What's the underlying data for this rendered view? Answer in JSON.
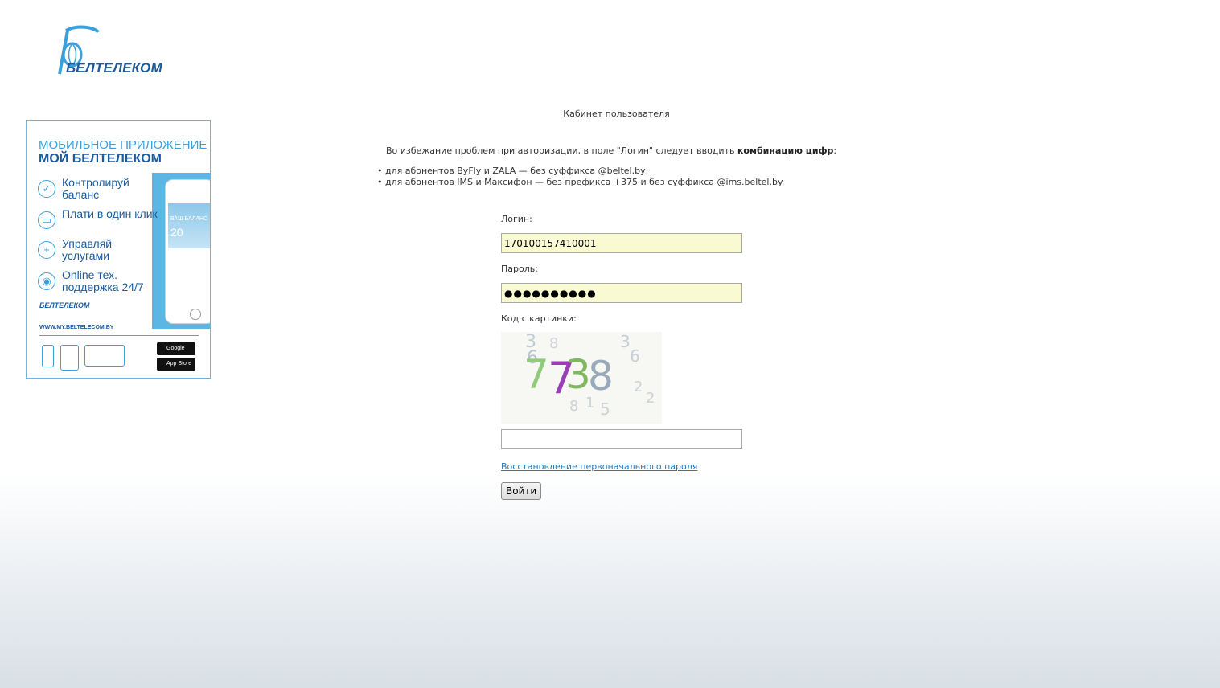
{
  "header": {
    "logo_text": "БЕЛТЕЛЕКОМ"
  },
  "banner": {
    "line1": "МОБИЛЬНОЕ ПРИЛОЖЕНИЕ",
    "line2": "МОЙ БЕЛТЕЛЕКОМ",
    "items": [
      "Контролируй баланс",
      "Плати в один клик",
      "Управляй услугами",
      "Online тех. поддержка 24/7"
    ],
    "phone_balance_label": "ВАШ БАЛАНС",
    "phone_balance_value": "20",
    "logo_text": "БЕЛТЕЛЕКОМ",
    "url": "WWW.MY.BELTELECOM.BY",
    "store_google": "Google Play",
    "store_apple": "App Store"
  },
  "page": {
    "title": "Кабинет пользователя"
  },
  "notice": {
    "text": "Во избежание проблем при авторизации, в поле \"Логин\" следует вводить ",
    "bold": "комбинацию цифр",
    "tail": ":",
    "bullets": [
      "• для абонентов ByFly и ZALA — без суффикса @beltel.by,",
      "• для абонентов IMS и Максифон — без префикса +375 и без суффикса @ims.beltel.by."
    ]
  },
  "form": {
    "login_label": "Логин:",
    "login_value": "170100157410001",
    "password_label": "Пароль:",
    "password_value": "●●●●●●●●●●",
    "captcha_label": "Код с картинки:",
    "captcha_code": [
      "7",
      "7",
      "3",
      "8"
    ],
    "captcha_value": "",
    "recover_link": "Восстановление первоначального пароля",
    "submit_label": "Войти"
  },
  "colors": {
    "brand": "#1b5a9c",
    "accent": "#3aa0dc",
    "link": "#2a79b7",
    "autofill": "#fafad2"
  }
}
